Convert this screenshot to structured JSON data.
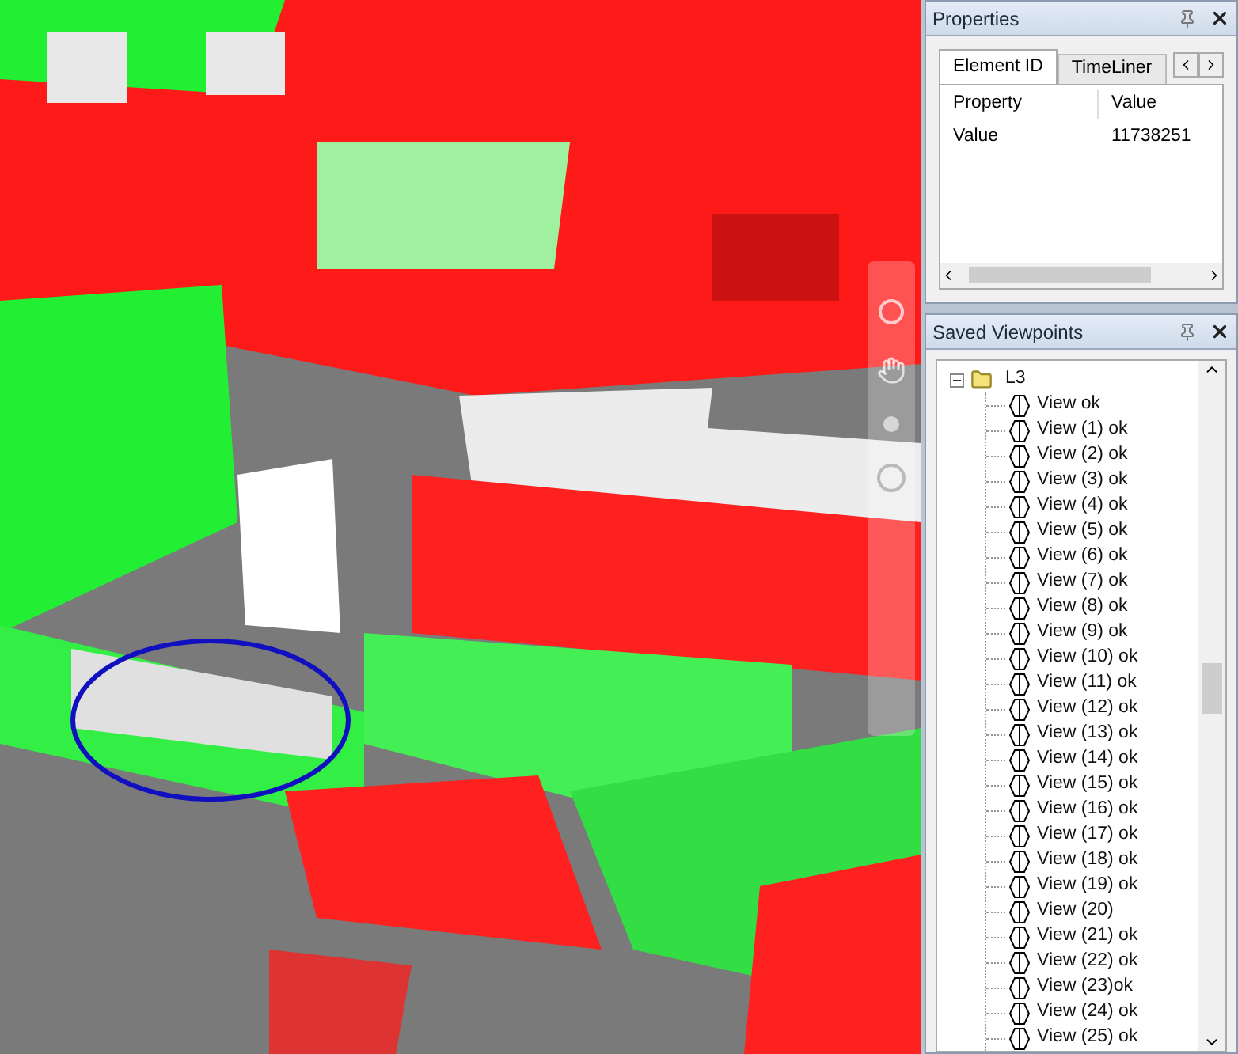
{
  "properties": {
    "title": "Properties",
    "tabs": [
      {
        "label": "Element ID",
        "selected": true
      },
      {
        "label": "TimeLiner",
        "selected": false
      }
    ],
    "columns": [
      "Property",
      "Value"
    ],
    "rows": [
      [
        "Value",
        "11738251"
      ]
    ]
  },
  "saved_viewpoints": {
    "title": "Saved Viewpoints",
    "tree": [
      {
        "label": "L3",
        "expanded": true,
        "children": [
          {
            "label": "View ok"
          },
          {
            "label": "View (1) ok"
          },
          {
            "label": "View (2) ok"
          },
          {
            "label": "View (3) ok"
          },
          {
            "label": "View (4) ok"
          },
          {
            "label": "View (5) ok"
          },
          {
            "label": "View (6) ok"
          },
          {
            "label": "View (7) ok"
          },
          {
            "label": "View (8) ok"
          },
          {
            "label": "View (9) ok"
          },
          {
            "label": "View (10) ok"
          },
          {
            "label": "View (11) ok"
          },
          {
            "label": "View (12) ok"
          },
          {
            "label": "View (13) ok"
          },
          {
            "label": "View (14) ok"
          },
          {
            "label": "View (15) ok"
          },
          {
            "label": "View (16) ok"
          },
          {
            "label": "View (17) ok"
          },
          {
            "label": "View (18) ok"
          },
          {
            "label": "View (19) ok"
          },
          {
            "label": "View (20)"
          },
          {
            "label": "View (21) ok"
          },
          {
            "label": "View (22) ok"
          },
          {
            "label": "View (23)ok"
          },
          {
            "label": "View (24) ok"
          },
          {
            "label": "View (25) ok"
          }
        ]
      }
    ]
  }
}
